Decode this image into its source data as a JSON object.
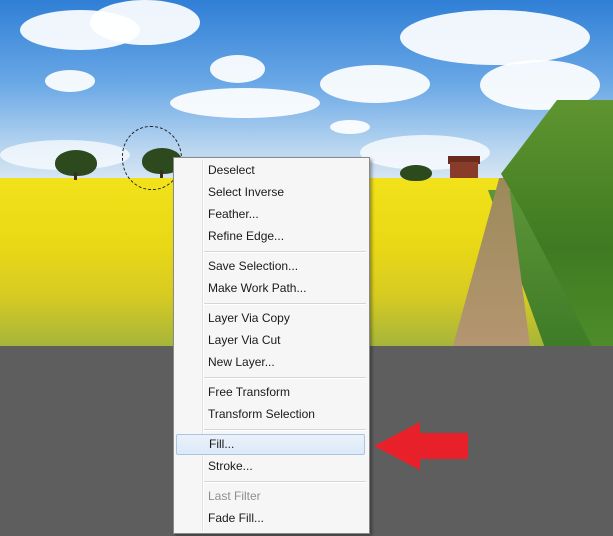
{
  "colors": {
    "menu_bg": "#f6f6f6",
    "highlight_border": "#a9c4e6",
    "arrow": "#e8202a",
    "workspace": "#5e5e5e"
  },
  "context_menu": {
    "groups": [
      [
        "Deselect",
        "Select Inverse",
        "Feather...",
        "Refine Edge..."
      ],
      [
        "Save Selection...",
        "Make Work Path..."
      ],
      [
        "Layer Via Copy",
        "Layer Via Cut",
        "New Layer..."
      ],
      [
        "Free Transform",
        "Transform Selection"
      ],
      [
        "Fill...",
        "Stroke..."
      ],
      [
        "Last Filter",
        "Fade Fill..."
      ]
    ],
    "highlighted": "Fill...",
    "disabled": [
      "Last Filter"
    ]
  },
  "annotation": {
    "icon": "red-arrow-icon"
  }
}
